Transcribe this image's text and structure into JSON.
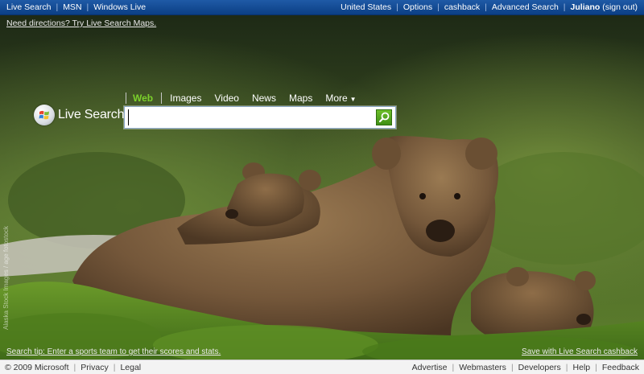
{
  "topbar": {
    "left_links": [
      "Live Search",
      "MSN",
      "Windows Live"
    ],
    "right_links": [
      "United States",
      "Options",
      "cashback",
      "Advanced Search"
    ],
    "user": "Juliano",
    "signout": "(sign out)"
  },
  "directions_link": "Need directions? Try Live Search Maps.",
  "logo": {
    "text": "Live Search",
    "tm": "TM"
  },
  "tabs": [
    {
      "label": "Web",
      "active": true
    },
    {
      "label": "Images"
    },
    {
      "label": "Video"
    },
    {
      "label": "News"
    },
    {
      "label": "Maps"
    },
    {
      "label": "More"
    }
  ],
  "search": {
    "value": ""
  },
  "photo_credit": "Alaska Stock Images / age fotostock",
  "tip": "Search tip: Enter a sports team to get their scores and stats.",
  "cashback_link": "Save with Live Search cashback",
  "footer": {
    "copyright": "© 2009 Microsoft",
    "left_links": [
      "Privacy",
      "Legal"
    ],
    "right_links": [
      "Advertise",
      "Webmasters",
      "Developers",
      "Help",
      "Feedback"
    ]
  },
  "colors": {
    "topbar": "#0b3f85",
    "active_tab": "#7bd12b",
    "search_button": "#4a9a1c"
  }
}
